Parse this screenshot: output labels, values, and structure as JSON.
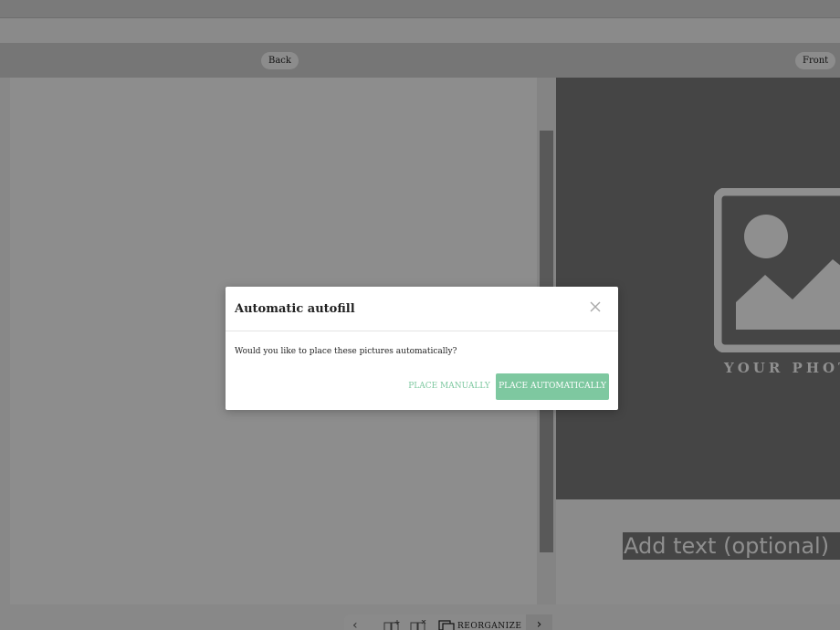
{
  "editor": {
    "back_label": "Back",
    "front_label": "Front",
    "photo_placeholder_text": "YOUR PHOTO",
    "text_field_placeholder": "Add text (optional)",
    "toolbar": {
      "prev_icon": "chevron-left-icon",
      "add_page_icon": "add-page-icon",
      "remove_page_icon": "remove-page-icon",
      "reorganize_icon": "copy-pages-icon",
      "reorganize_label": "REORGANIZE",
      "next_icon": "chevron-right-icon"
    }
  },
  "modal": {
    "title": "Automatic autofill",
    "close_icon": "close-icon",
    "message": "Would you like to place these pictures automatically?",
    "manual_label": "PLACE MANUALLY",
    "auto_label": "PLACE AUTOMATICALLY"
  },
  "colors": {
    "accent": "#7ec8a0",
    "overlay_gray": "#888888",
    "photo_slot": "#454545"
  }
}
